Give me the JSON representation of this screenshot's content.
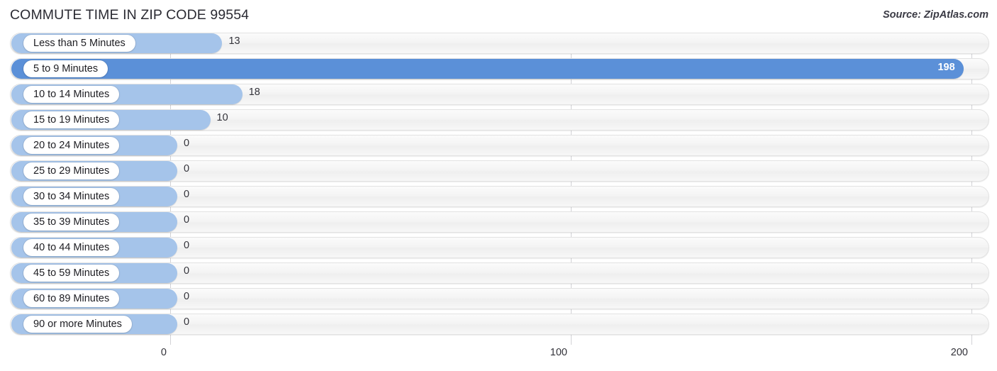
{
  "header": {
    "title": "COMMUTE TIME IN ZIP CODE 99554",
    "source": "Source: ZipAtlas.com"
  },
  "colors": {
    "bar": "#a5c4ea",
    "bar_highlight": "#5b90d8",
    "track": "#f4f4f4",
    "gridline": "#d2d2d6",
    "text": "#33333a"
  },
  "chart_data": {
    "type": "bar",
    "orientation": "horizontal",
    "title": "COMMUTE TIME IN ZIP CODE 99554",
    "xlabel": "",
    "ylabel": "",
    "xlim": [
      0,
      200
    ],
    "xticks": [
      0,
      100,
      200
    ],
    "xtick_labels": [
      "0",
      "100",
      "200"
    ],
    "grid": true,
    "legend": false,
    "highlight_index": 1,
    "categories": [
      "Less than 5 Minutes",
      "5 to 9 Minutes",
      "10 to 14 Minutes",
      "15 to 19 Minutes",
      "20 to 24 Minutes",
      "25 to 29 Minutes",
      "30 to 34 Minutes",
      "35 to 39 Minutes",
      "40 to 44 Minutes",
      "45 to 59 Minutes",
      "60 to 89 Minutes",
      "90 or more Minutes"
    ],
    "values": [
      13,
      198,
      18,
      10,
      0,
      0,
      0,
      0,
      0,
      0,
      0,
      0
    ],
    "value_labels": [
      "13",
      "198",
      "18",
      "10",
      "0",
      "0",
      "0",
      "0",
      "0",
      "0",
      "0",
      "0"
    ]
  }
}
